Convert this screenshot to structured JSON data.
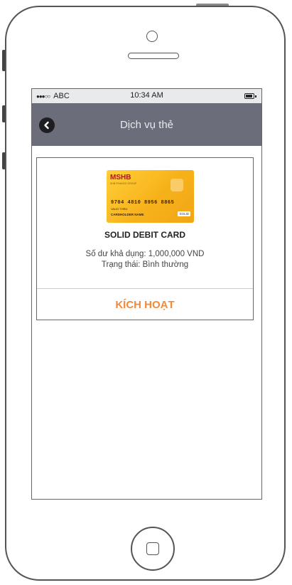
{
  "status_bar": {
    "signal_dots": "●●●○○",
    "carrier": "ABC",
    "time": "10:34 AM"
  },
  "nav": {
    "title": "Dịch vụ thẻ",
    "back_icon": "chevron-left-circle-icon"
  },
  "card": {
    "bank_logo": "MSHB",
    "bank_logo_sub": "SHB FINANCE GROUP",
    "card_number": "9704 4810 8956 8865",
    "card_small_text": "VALID THRU",
    "card_holder": "CARDHOLDER NAME",
    "card_brand": "SOLID",
    "name": "SOLID DEBIT CARD",
    "balance": "Số dư khả dụng: 1,000,000 VND",
    "status": "Trạng thái: Bình thường",
    "activate_label": "KÍCH HOẠT"
  },
  "colors": {
    "nav_bg": "#6b6d7a",
    "accent": "#f08a3c",
    "card_gold": "#f7b21a"
  }
}
